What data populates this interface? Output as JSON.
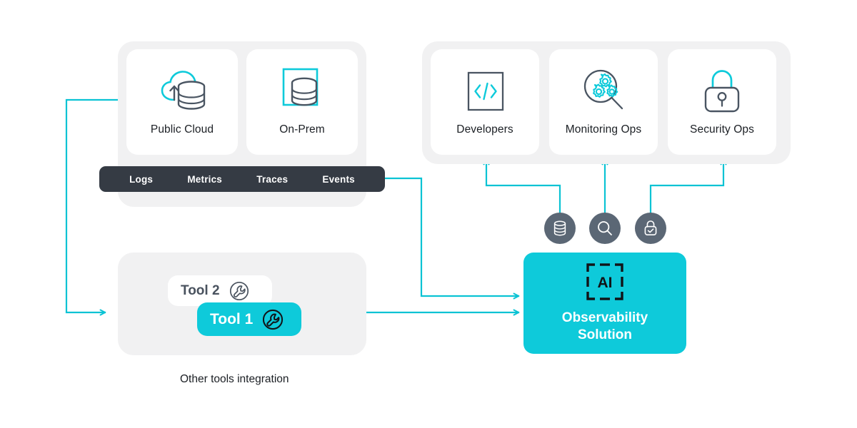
{
  "theme": {
    "accent": "#0ecada",
    "dark": "#353b44",
    "slate": "#5b6775",
    "panel_bg": "#f1f1f2",
    "card_bg": "#ffffff",
    "text": "#1b1f24",
    "wire": "#0bc3d4"
  },
  "sources": {
    "cards": [
      {
        "label": "Public Cloud",
        "icon": "cloud-upload-database-icon"
      },
      {
        "label": "On-Prem",
        "icon": "onprem-database-icon"
      }
    ]
  },
  "telemetry": {
    "items": [
      {
        "label": "Logs"
      },
      {
        "label": "Metrics"
      },
      {
        "label": "Traces"
      },
      {
        "label": "Events"
      }
    ]
  },
  "tools": {
    "caption": "Other tools integration",
    "chips": [
      {
        "label": "Tool 2",
        "icon": "wrench-circle-icon",
        "style": "secondary"
      },
      {
        "label": "Tool 1",
        "icon": "wrench-circle-icon",
        "style": "primary"
      }
    ]
  },
  "solution": {
    "badge_text": "AI",
    "title": "Observability\nSolution",
    "capabilities": [
      {
        "name": "database-badge",
        "icon": "database-icon"
      },
      {
        "name": "search-badge",
        "icon": "magnifier-icon"
      },
      {
        "name": "security-badge",
        "icon": "lock-check-icon"
      }
    ]
  },
  "consumers": {
    "cards": [
      {
        "label": "Developers",
        "icon": "code-brackets-icon"
      },
      {
        "label": "Monitoring Ops",
        "icon": "gears-magnifier-icon"
      },
      {
        "label": "Security Ops",
        "icon": "padlock-icon"
      }
    ]
  }
}
